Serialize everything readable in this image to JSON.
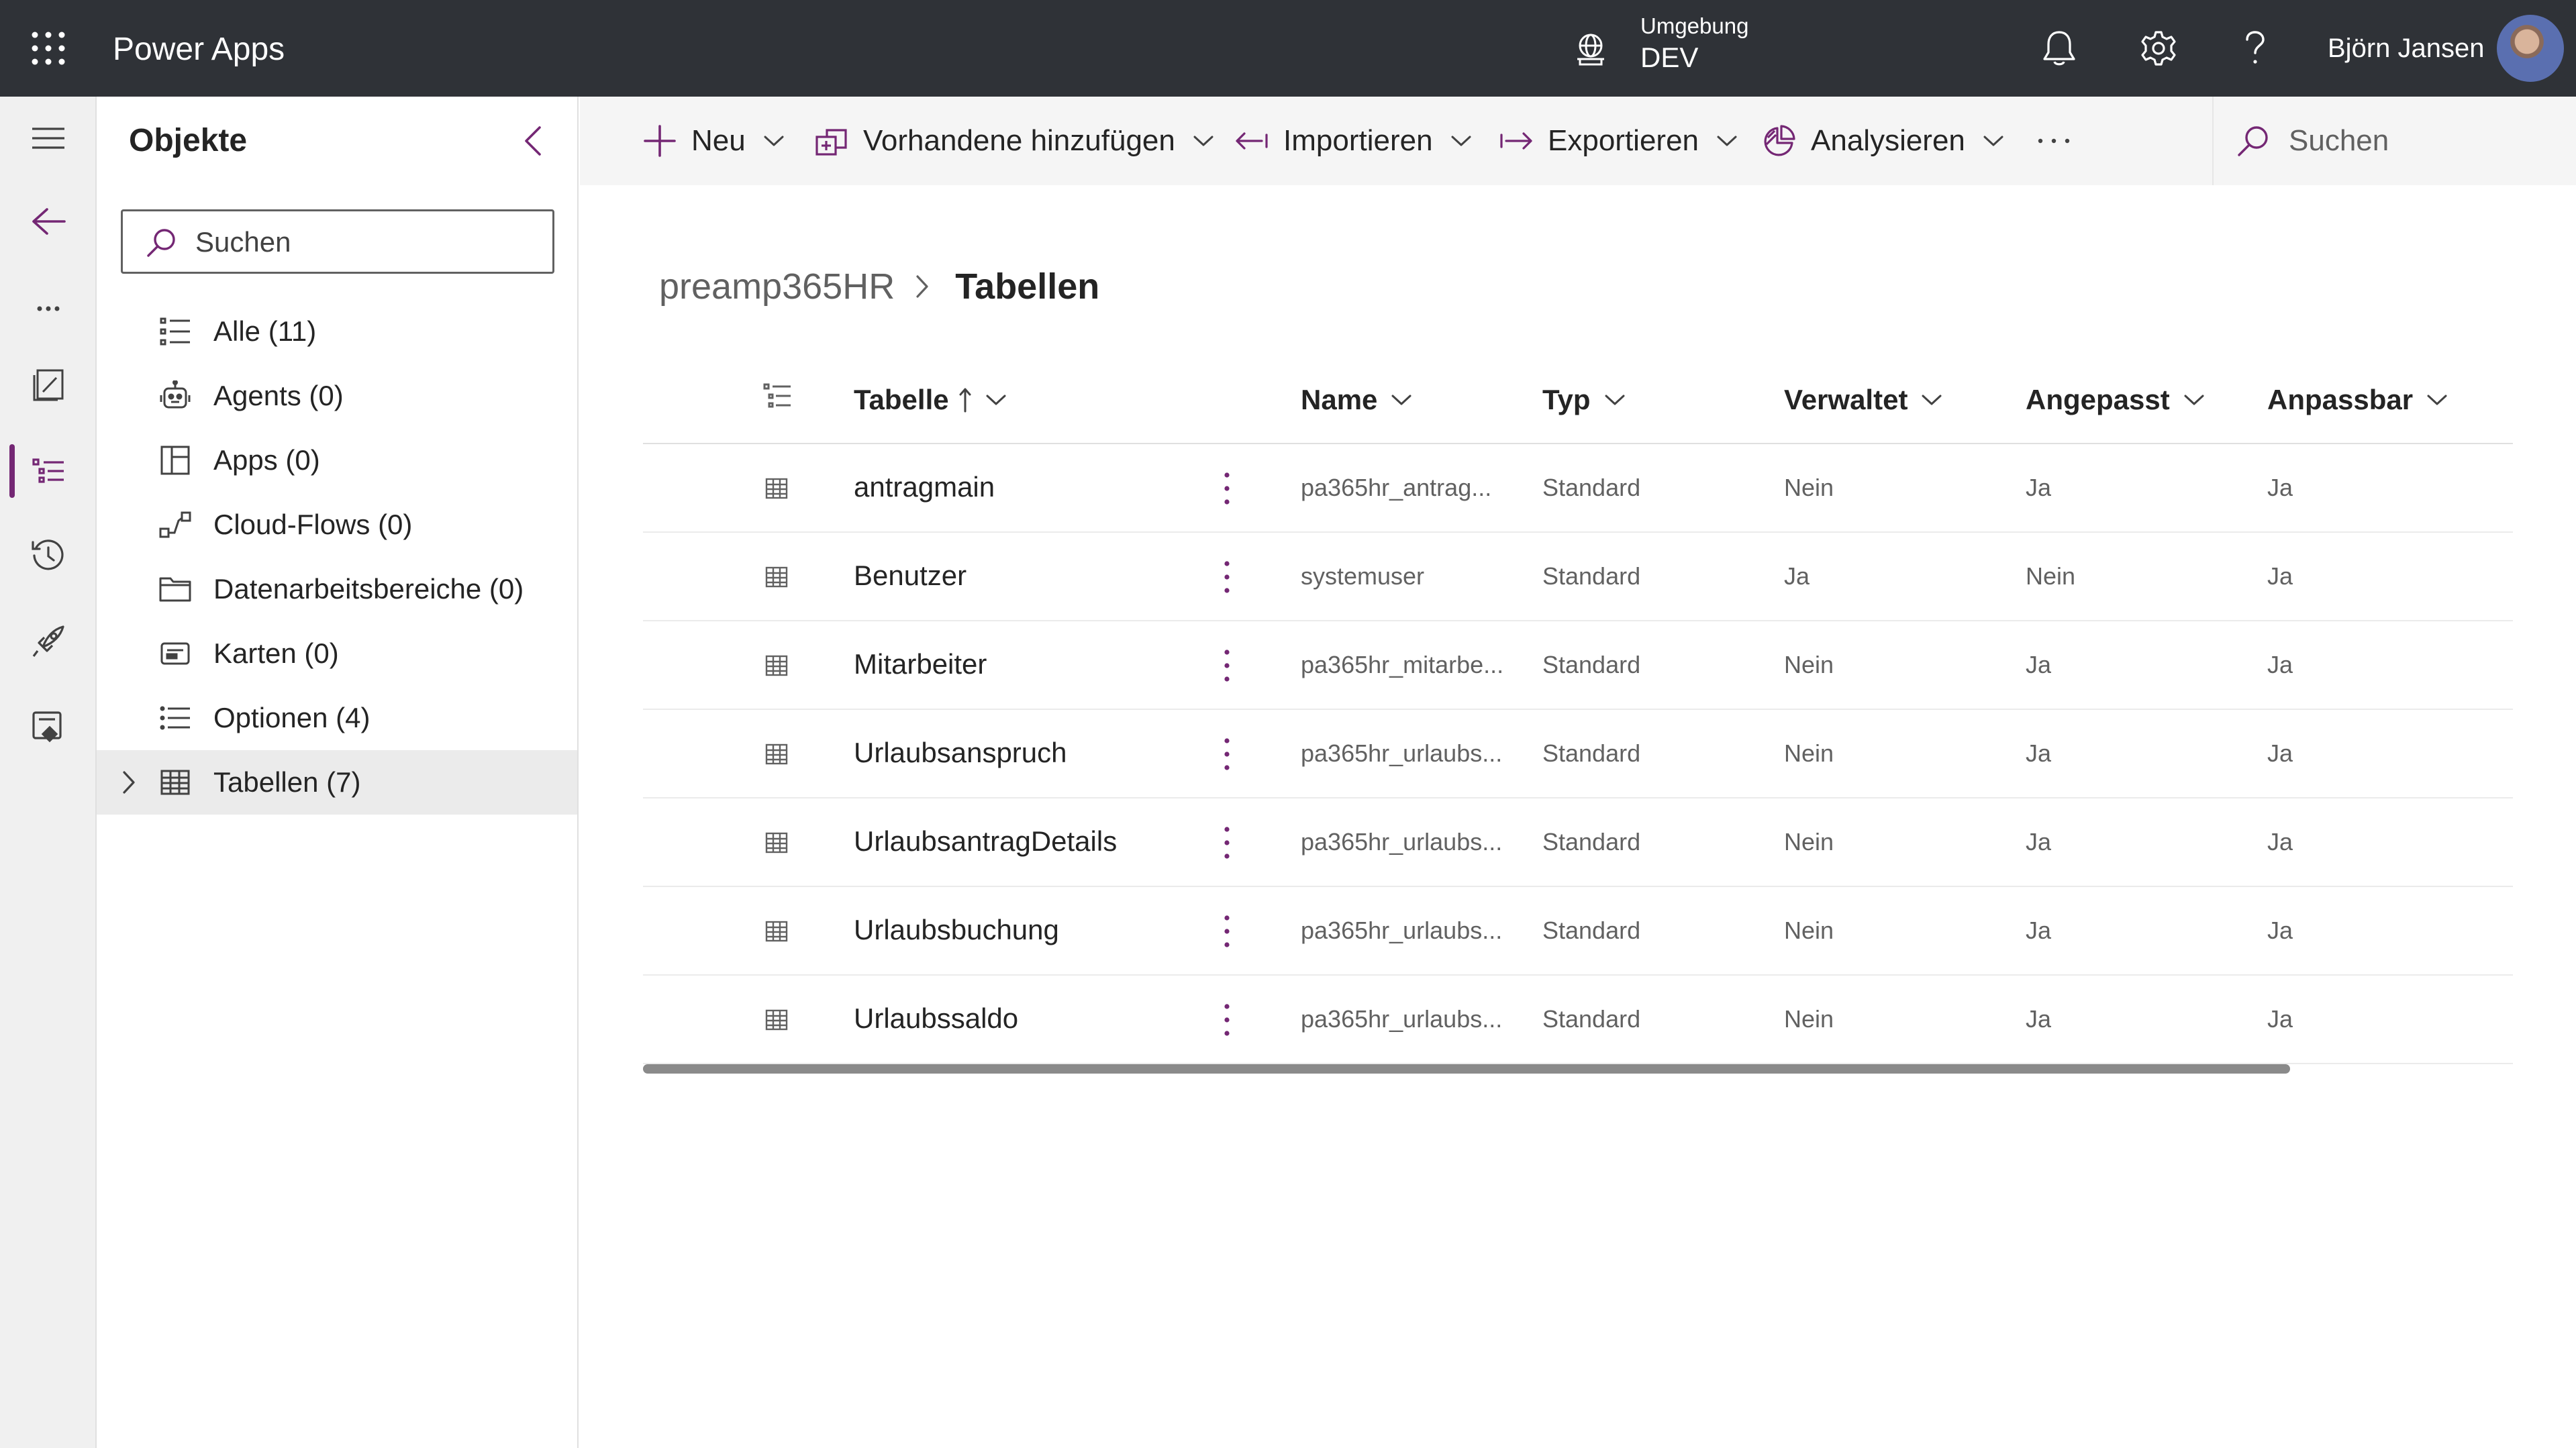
{
  "topbar": {
    "app_title": "Power Apps",
    "environment_label": "Umgebung",
    "environment_value": "DEV",
    "user_name": "Björn Jansen"
  },
  "objects_panel": {
    "title": "Objekte",
    "search_placeholder": "Suchen",
    "items": [
      {
        "label": "Alle  (11)",
        "icon": "list-icon"
      },
      {
        "label": "Agents  (0)",
        "icon": "bot-icon"
      },
      {
        "label": "Apps  (0)",
        "icon": "apps-icon"
      },
      {
        "label": "Cloud-Flows  (0)",
        "icon": "flow-icon"
      },
      {
        "label": "Datenarbeitsbereiche  (0)",
        "icon": "folder-icon"
      },
      {
        "label": "Karten  (0)",
        "icon": "card-icon"
      },
      {
        "label": "Optionen  (4)",
        "icon": "options-list-icon"
      },
      {
        "label": "Tabellen  (7)",
        "icon": "table-icon",
        "selected": true
      }
    ]
  },
  "commandbar": {
    "new_label": "Neu",
    "add_existing_label": "Vorhandene hinzufügen",
    "import_label": "Importieren",
    "export_label": "Exportieren",
    "analyze_label": "Analysieren",
    "more_label": "···",
    "search_placeholder": "Suchen"
  },
  "breadcrumb": {
    "parent": "preamp365HR",
    "current": "Tabellen"
  },
  "table": {
    "columns": {
      "tabelle": "Tabelle",
      "name": "Name",
      "typ": "Typ",
      "verwaltet": "Verwaltet",
      "angepasst": "Angepasst",
      "anpassbar": "Anpassbar"
    },
    "sort_indicator": "↑",
    "rows": [
      {
        "tabelle": "antragmain",
        "name": "pa365hr_antrag...",
        "typ": "Standard",
        "verwaltet": "Nein",
        "angepasst": "Ja",
        "anpassbar": "Ja"
      },
      {
        "tabelle": "Benutzer",
        "name": "systemuser",
        "typ": "Standard",
        "verwaltet": "Ja",
        "angepasst": "Nein",
        "anpassbar": "Ja"
      },
      {
        "tabelle": "Mitarbeiter",
        "name": "pa365hr_mitarbe...",
        "typ": "Standard",
        "verwaltet": "Nein",
        "angepasst": "Ja",
        "anpassbar": "Ja"
      },
      {
        "tabelle": "Urlaubsanspruch",
        "name": "pa365hr_urlaubs...",
        "typ": "Standard",
        "verwaltet": "Nein",
        "angepasst": "Ja",
        "anpassbar": "Ja"
      },
      {
        "tabelle": "UrlaubsantragDetails",
        "name": "pa365hr_urlaubs...",
        "typ": "Standard",
        "verwaltet": "Nein",
        "angepasst": "Ja",
        "anpassbar": "Ja"
      },
      {
        "tabelle": "Urlaubsbuchung",
        "name": "pa365hr_urlaubs...",
        "typ": "Standard",
        "verwaltet": "Nein",
        "angepasst": "Ja",
        "anpassbar": "Ja"
      },
      {
        "tabelle": "Urlaubssaldo",
        "name": "pa365hr_urlaubs...",
        "typ": "Standard",
        "verwaltet": "Nein",
        "angepasst": "Ja",
        "anpassbar": "Ja"
      }
    ]
  },
  "colors": {
    "topbar_bg": "#2f3237",
    "accent": "#742774",
    "rail_bg": "#f0f0f0",
    "command_bg": "#f5f5f5"
  }
}
